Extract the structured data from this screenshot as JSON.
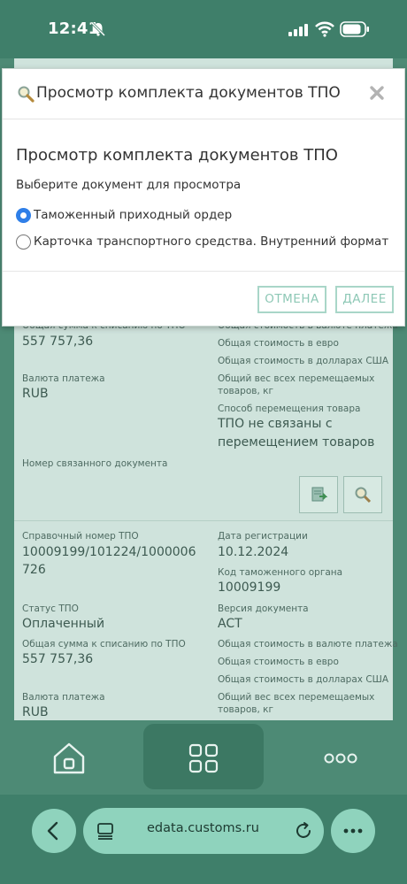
{
  "status_bar": {
    "time": "12:41"
  },
  "dialog": {
    "header_title": "Просмотр комплекта документов ТПО",
    "heading": "Просмотр комплекта документов ТПО",
    "subtitle": "Выберите документ для просмотра",
    "options": [
      {
        "label": "Таможенный приходный ордер",
        "selected": true
      },
      {
        "label": "Карточка транспортного средства. Внутренний формат",
        "selected": false
      }
    ],
    "cancel_label": "ОТМЕНА",
    "next_label": "ДАЛЕЕ"
  },
  "record1": {
    "total_label": "Общая сумма к списанию по ТПО",
    "total_value": "557 757,36",
    "currency_label": "Валюта платежа",
    "currency_value": "RUB",
    "related_label": "Номер связанного документа",
    "cost_payment_label": "Общая стоимость в валюте платежа",
    "cost_eur_label": "Общая стоимость в евро",
    "cost_usd_label": "Общая стоимость в долларах США",
    "weight_label_1": "Общий вес всех перемещаемых",
    "weight_label_2": "товаров, кг",
    "method_label": "Способ перемещения товара",
    "method_value_1": "ТПО не связаны с",
    "method_value_2": "перемещением товаров"
  },
  "record2": {
    "ref_label": "Справочный номер ТПО",
    "ref_value_1": "10009199/101224/1000006",
    "ref_value_2": "726",
    "status_label": "Статус ТПО",
    "status_value": "Оплаченный",
    "total_label": "Общая сумма к списанию по ТПО",
    "total_value": "557 757,36",
    "currency_label": "Валюта платежа",
    "currency_value": "RUB",
    "reg_date_label": "Дата регистрации",
    "reg_date_value": "10.12.2024",
    "customs_code_label": "Код таможенного органа",
    "customs_code_value": "10009199",
    "version_label": "Версия документа",
    "version_value": "ACT",
    "cost_payment_label": "Общая стоимость в валюте платежа",
    "cost_eur_label": "Общая стоимость в евро",
    "cost_usd_label": "Общая стоимость в долларах США",
    "weight_label_1": "Общий вес всех перемещаемых",
    "weight_label_2": "товаров, кг"
  },
  "browser": {
    "url": "edata.customs.ru"
  },
  "colors": {
    "brand_green": "#3f7f6a",
    "accent_mint": "#8fd3bd",
    "radio_blue": "#2f7fe8"
  },
  "icons": [
    "bell-slash-icon",
    "signal-icon",
    "wifi-icon",
    "battery-icon",
    "magnifier-icon",
    "close-icon",
    "document-export-icon",
    "search-icon",
    "home-icon",
    "grid-icon",
    "more-icon",
    "back-icon",
    "tabs-icon",
    "reload-icon",
    "menu-icon"
  ]
}
